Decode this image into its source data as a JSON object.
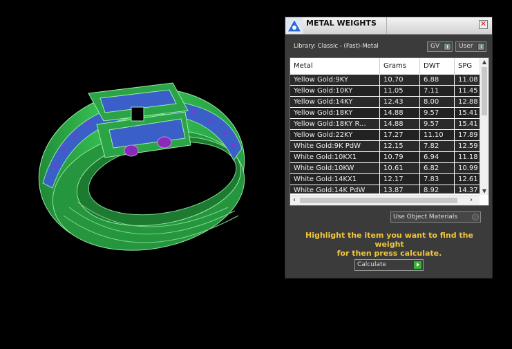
{
  "panel": {
    "title": "METAL WEIGHTS",
    "close_glyph": "✕",
    "library_label": "Library: Classic - (Fast)-Metal",
    "toggle_gv": "GV",
    "toggle_user": "User",
    "use_object_materials": "Use Object Materials",
    "hint_line1": "Highlight the item you want to find the weight",
    "hint_line2": "for then press calculate.",
    "calculate_label": "Calculate"
  },
  "table": {
    "headers": {
      "metal": "Metal",
      "grams": "Grams",
      "dwt": "DWT",
      "spg": "SPG"
    },
    "rows": [
      {
        "metal": "Yellow Gold:9KY",
        "grams": "10.70",
        "dwt": "6.88",
        "spg": "11.08"
      },
      {
        "metal": "Yellow Gold:10KY",
        "grams": "11.05",
        "dwt": "7.11",
        "spg": "11.45"
      },
      {
        "metal": "Yellow Gold:14KY",
        "grams": "12.43",
        "dwt": "8.00",
        "spg": "12.88"
      },
      {
        "metal": "Yellow Gold:18KY",
        "grams": "14.88",
        "dwt": "9.57",
        "spg": "15.41"
      },
      {
        "metal": "Yellow Gold:18KY R...",
        "grams": "14.88",
        "dwt": "9.57",
        "spg": "15.41"
      },
      {
        "metal": "Yellow Gold:22KY",
        "grams": "17.27",
        "dwt": "11.10",
        "spg": "17.89"
      },
      {
        "metal": "White Gold:9K PdW",
        "grams": "12.15",
        "dwt": "7.82",
        "spg": "12.59"
      },
      {
        "metal": "White Gold:10KX1",
        "grams": "10.79",
        "dwt": "6.94",
        "spg": "11.18"
      },
      {
        "metal": "White Gold:10KW",
        "grams": "10.61",
        "dwt": "6.82",
        "spg": "10.99"
      },
      {
        "metal": "White Gold:14KX1",
        "grams": "12.17",
        "dwt": "7.83",
        "spg": "12.61"
      },
      {
        "metal": "White Gold:14K PdW",
        "grams": "13.87",
        "dwt": "8.92",
        "spg": "14.37"
      }
    ]
  },
  "colors": {
    "ring_green": "#2fae4a",
    "channel_blue": "#3a5fc8",
    "gem_purple": "#8a2ab8",
    "hint_yellow": "#f0c63c"
  }
}
